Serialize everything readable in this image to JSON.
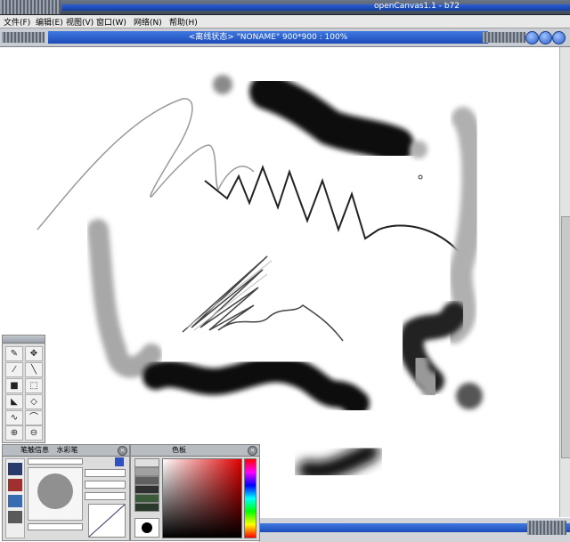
{
  "window": {
    "title": "openCanvas1.1 - b72"
  },
  "menu": [
    {
      "label": "文件(F)"
    },
    {
      "label": "编辑(E)"
    },
    {
      "label": "视图(V)"
    },
    {
      "label": "窗口(W)"
    },
    {
      "label": "网络(N)"
    },
    {
      "label": "帮助(H)"
    }
  ],
  "document": {
    "title": "<离线状态> \"NONAME\" 900*900 : 100%"
  },
  "panels": {
    "brush": {
      "tab1": "笔触信息",
      "tab2": "水彩笔"
    },
    "color": {
      "title": "色板"
    }
  },
  "colors": {
    "accent": "#1c4cb8",
    "chrome": "#c9cdd3"
  }
}
